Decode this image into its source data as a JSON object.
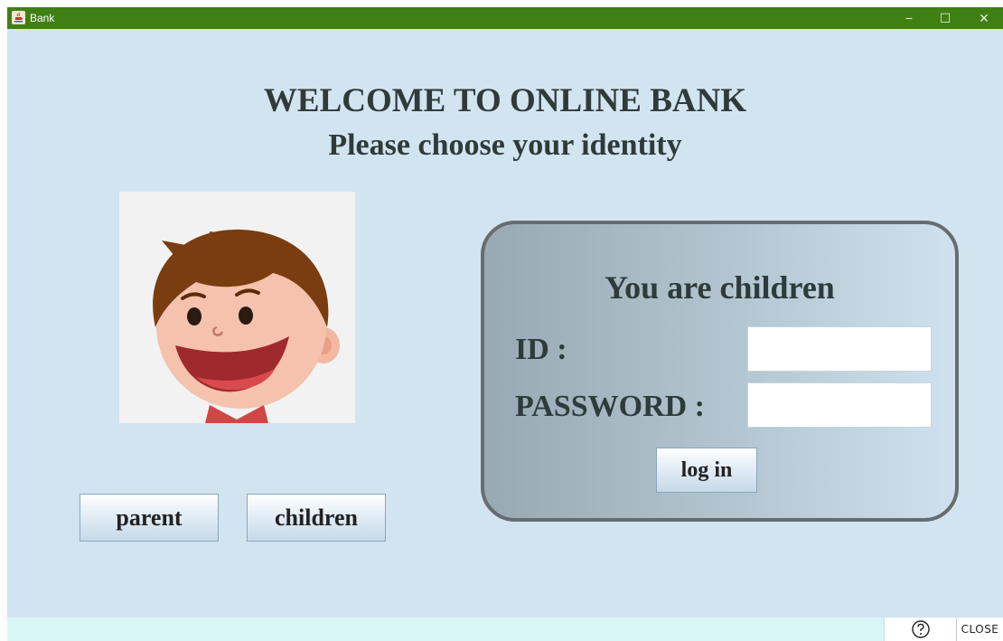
{
  "window": {
    "title": "Bank",
    "controls": {
      "minimize": "−",
      "maximize": "☐",
      "close": "✕"
    }
  },
  "header": {
    "title": "WELCOME TO ONLINE BANK",
    "subtitle": "Please choose your identity"
  },
  "identity": {
    "portrait_icon": "cartoon-boy-face",
    "parent_label": "parent",
    "children_label": "children"
  },
  "login_panel": {
    "title": "You are children",
    "id_label": "ID :",
    "password_label": "PASSWORD :",
    "id_value": "",
    "password_value": "",
    "login_label": "log in"
  },
  "footer": {
    "help_icon": "help-circle-icon",
    "close_label": "CLOSE"
  },
  "colors": {
    "titlebar": "#3f7f14",
    "window_bg": "#d2e4f0",
    "panel_border": "#676c6f",
    "heading_text": "#2f3a3a",
    "statusbar": "#d8f6f6"
  }
}
